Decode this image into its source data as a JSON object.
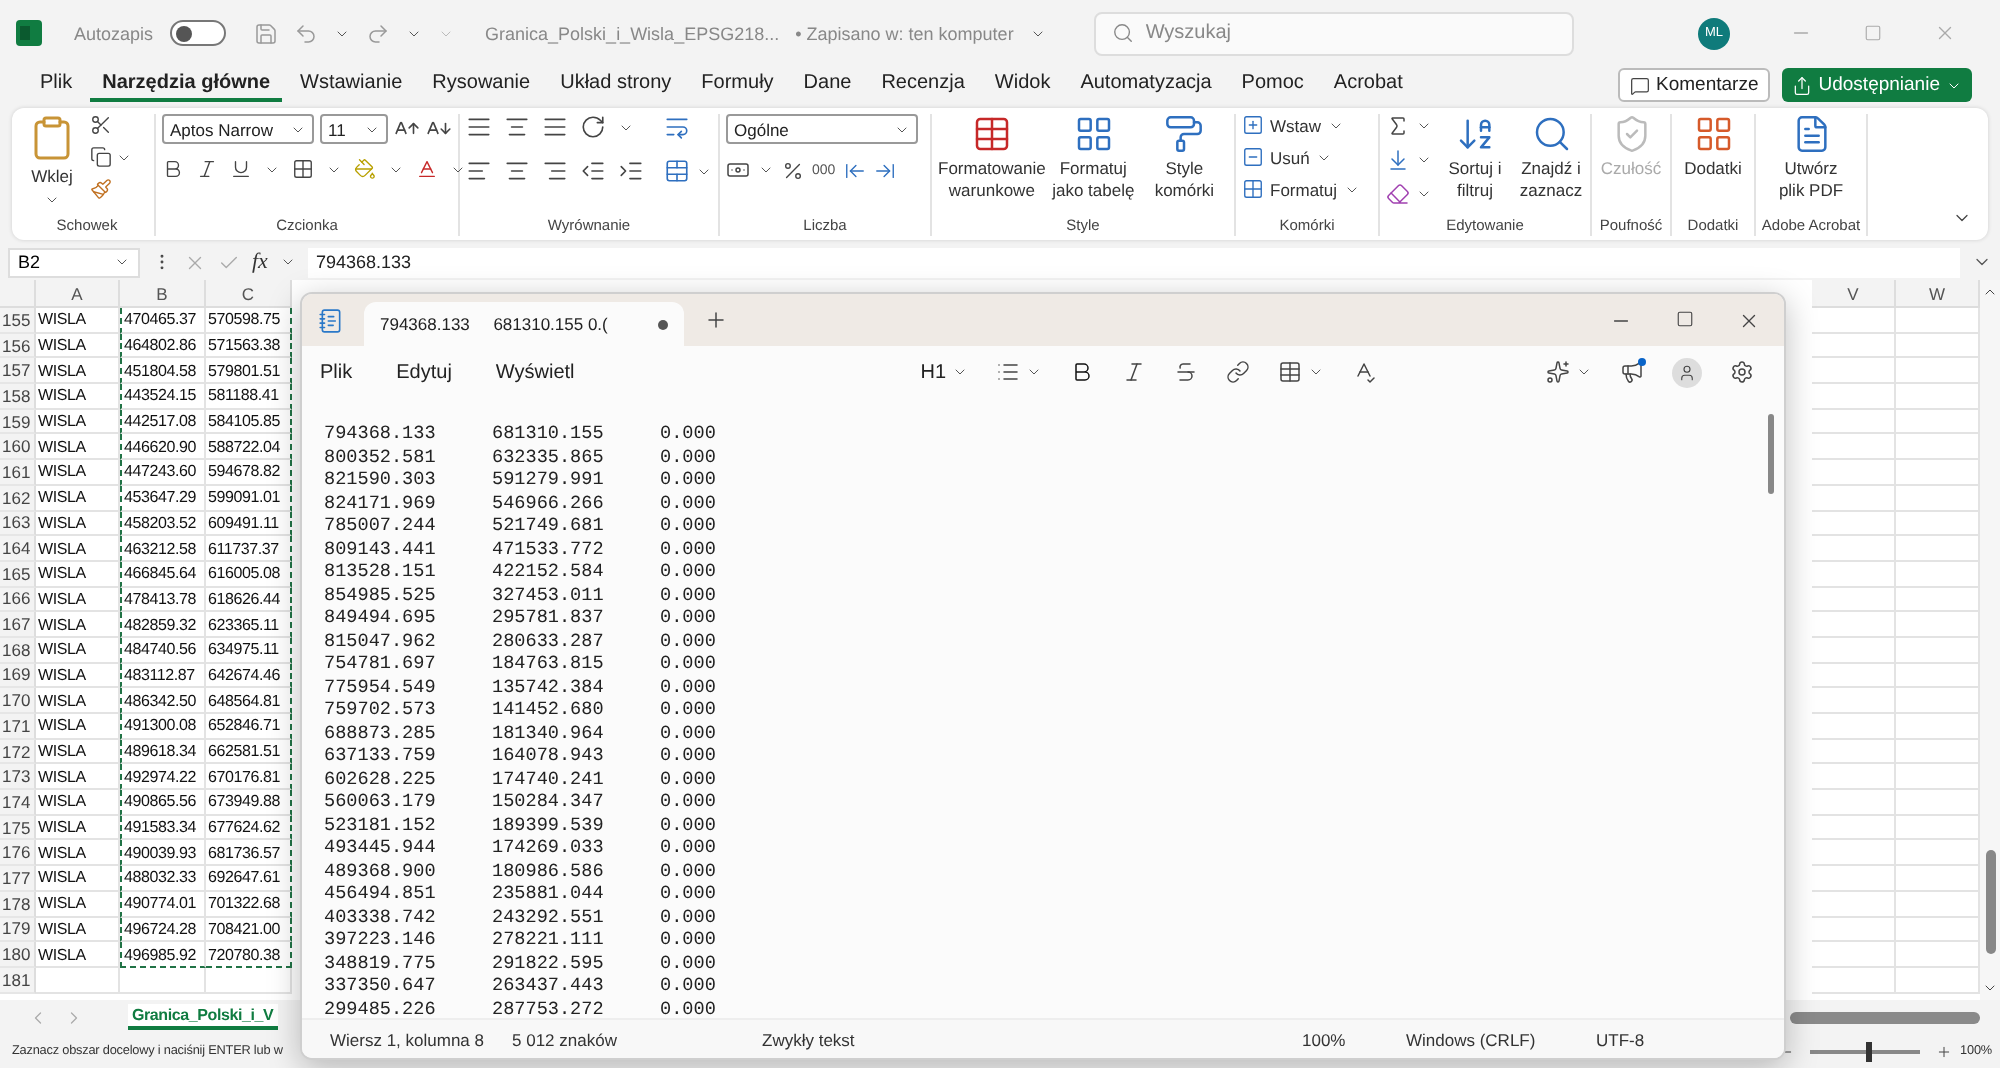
{
  "excel": {
    "title_bar": {
      "autosave_label": "Autozapis",
      "autosave_on": false,
      "file_name": "Granica_Polski_i_Wisla_EPSG218...",
      "save_status": "• Zapisano w: ten komputer",
      "search_placeholder": "Wyszukaj",
      "avatar": "ML"
    },
    "menu_tabs": [
      {
        "label": "Plik",
        "selected": false
      },
      {
        "label": "Narzędzia główne",
        "selected": true
      },
      {
        "label": "Wstawianie",
        "selected": false
      },
      {
        "label": "Rysowanie",
        "selected": false
      },
      {
        "label": "Układ strony",
        "selected": false
      },
      {
        "label": "Formuły",
        "selected": false
      },
      {
        "label": "Dane",
        "selected": false
      },
      {
        "label": "Recenzja",
        "selected": false
      },
      {
        "label": "Widok",
        "selected": false
      },
      {
        "label": "Automatyzacja",
        "selected": false
      },
      {
        "label": "Pomoc",
        "selected": false
      },
      {
        "label": "Acrobat",
        "selected": false
      }
    ],
    "comments_button": "Komentarze",
    "share_button": "Udostępnianie",
    "ribbon": {
      "clipboard": {
        "name": "Schowek",
        "paste": "Wklej"
      },
      "font": {
        "name": "Czcionka",
        "font_family": "Aptos Narrow",
        "font_size": "11"
      },
      "alignment": {
        "name": "Wyrównanie"
      },
      "number": {
        "name": "Liczba",
        "format": "Ogólne",
        "thousands": "000"
      },
      "styles": {
        "name": "Style",
        "buttons": [
          "Formatowanie warunkowe",
          "Formatuj jako tabelę",
          "Style komórki"
        ]
      },
      "cells": {
        "name": "Komórki",
        "buttons": [
          "Wstaw",
          "Usuń",
          "Formatuj"
        ]
      },
      "editing": {
        "name": "Edytowanie",
        "buttons": [
          "Sortuj i filtruj",
          "Znajdź i zaznacz"
        ]
      },
      "sensitivity": {
        "name": "Poufność",
        "button": "Czułość",
        "disabled": true
      },
      "addins": {
        "name": "Dodatki",
        "button": "Dodatki"
      },
      "acrobat": {
        "name": "Adobe Acrobat",
        "button": "Utwórz plik PDF"
      }
    },
    "formula_bar": {
      "name_box": "B2",
      "function_label": "fx",
      "formula": "794368.133"
    },
    "columns": [
      "A",
      "B",
      "C"
    ],
    "columns_right": [
      "V",
      "W"
    ],
    "rows": [
      {
        "number": "155",
        "cells": [
          "WISLA",
          "470465.37",
          "570598.75"
        ]
      },
      {
        "number": "156",
        "cells": [
          "WISLA",
          "464802.86",
          "571563.38"
        ]
      },
      {
        "number": "157",
        "cells": [
          "WISLA",
          "451804.58",
          "579801.51"
        ]
      },
      {
        "number": "158",
        "cells": [
          "WISLA",
          "443524.15",
          "581188.41"
        ]
      },
      {
        "number": "159",
        "cells": [
          "WISLA",
          "442517.08",
          "584105.85"
        ]
      },
      {
        "number": "160",
        "cells": [
          "WISLA",
          "446620.90",
          "588722.04"
        ]
      },
      {
        "number": "161",
        "cells": [
          "WISLA",
          "447243.60",
          "594678.82"
        ]
      },
      {
        "number": "162",
        "cells": [
          "WISLA",
          "453647.29",
          "599091.01"
        ]
      },
      {
        "number": "163",
        "cells": [
          "WISLA",
          "458203.52",
          "609491.11"
        ]
      },
      {
        "number": "164",
        "cells": [
          "WISLA",
          "463212.58",
          "611737.37"
        ]
      },
      {
        "number": "165",
        "cells": [
          "WISLA",
          "466845.64",
          "616005.08"
        ]
      },
      {
        "number": "166",
        "cells": [
          "WISLA",
          "478413.78",
          "618626.44"
        ]
      },
      {
        "number": "167",
        "cells": [
          "WISLA",
          "482859.32",
          "623365.11"
        ]
      },
      {
        "number": "168",
        "cells": [
          "WISLA",
          "484740.56",
          "634975.11"
        ]
      },
      {
        "number": "169",
        "cells": [
          "WISLA",
          "483112.87",
          "642674.46"
        ]
      },
      {
        "number": "170",
        "cells": [
          "WISLA",
          "486342.50",
          "648564.81"
        ]
      },
      {
        "number": "171",
        "cells": [
          "WISLA",
          "491300.08",
          "652846.71"
        ]
      },
      {
        "number": "172",
        "cells": [
          "WISLA",
          "489618.34",
          "662581.51"
        ]
      },
      {
        "number": "173",
        "cells": [
          "WISLA",
          "492974.22",
          "670176.81"
        ]
      },
      {
        "number": "174",
        "cells": [
          "WISLA",
          "490865.56",
          "673949.88"
        ]
      },
      {
        "number": "175",
        "cells": [
          "WISLA",
          "491583.34",
          "677624.62"
        ]
      },
      {
        "number": "176",
        "cells": [
          "WISLA",
          "490039.93",
          "681736.57"
        ]
      },
      {
        "number": "177",
        "cells": [
          "WISLA",
          "488032.33",
          "692647.61"
        ]
      },
      {
        "number": "178",
        "cells": [
          "WISLA",
          "490774.01",
          "701322.68"
        ]
      },
      {
        "number": "179",
        "cells": [
          "WISLA",
          "496724.28",
          "708421.00"
        ]
      },
      {
        "number": "180",
        "cells": [
          "WISLA",
          "496985.92",
          "720780.38"
        ]
      },
      {
        "number": "181",
        "cells": []
      }
    ],
    "sheet_tab": "Granica_Polski_i_V",
    "status_text": "Zaznacz obszar docelowy i naciśnij ENTER lub w",
    "zoom": "100%",
    "zoom_slider": {
      "level": 0.5
    }
  },
  "notepad": {
    "tab_title": "794368.133\t681310.155 0.(",
    "unsaved": true,
    "menu": [
      "Plik",
      "Edytuj",
      "Wyświetl"
    ],
    "heading_button": "H1",
    "lines": [
      [
        "794368.133",
        "681310.155",
        "0.000"
      ],
      [
        "800352.581",
        "632335.865",
        "0.000"
      ],
      [
        "821590.303",
        "591279.991",
        "0.000"
      ],
      [
        "824171.969",
        "546966.266",
        "0.000"
      ],
      [
        "785007.244",
        "521749.681",
        "0.000"
      ],
      [
        "809143.441",
        "471533.772",
        "0.000"
      ],
      [
        "813528.151",
        "422152.584",
        "0.000"
      ],
      [
        "854985.525",
        "327453.011",
        "0.000"
      ],
      [
        "849494.695",
        "295781.837",
        "0.000"
      ],
      [
        "815047.962",
        "280633.287",
        "0.000"
      ],
      [
        "754781.697",
        "184763.815",
        "0.000"
      ],
      [
        "775954.549",
        "135742.384",
        "0.000"
      ],
      [
        "759702.573",
        "141452.680",
        "0.000"
      ],
      [
        "688873.285",
        "181340.964",
        "0.000"
      ],
      [
        "637133.759",
        "164078.943",
        "0.000"
      ],
      [
        "602628.225",
        "174740.241",
        "0.000"
      ],
      [
        "560063.179",
        "150284.347",
        "0.000"
      ],
      [
        "523181.152",
        "189399.539",
        "0.000"
      ],
      [
        "493445.944",
        "174269.033",
        "0.000"
      ],
      [
        "489368.900",
        "180986.586",
        "0.000"
      ],
      [
        "456494.851",
        "235881.044",
        "0.000"
      ],
      [
        "403338.742",
        "243292.551",
        "0.000"
      ],
      [
        "397223.146",
        "278221.111",
        "0.000"
      ],
      [
        "348819.775",
        "291822.595",
        "0.000"
      ],
      [
        "337350.647",
        "263437.443",
        "0.000"
      ],
      [
        "299485.226",
        "287753.272",
        "0.000"
      ]
    ],
    "status": {
      "position": "Wiersz 1, kolumna 8",
      "characters": "5 012 znaków",
      "format": "Zwykły tekst",
      "zoom": "100%",
      "line_endings": "Windows (CRLF)",
      "encoding": "UTF-8"
    }
  }
}
